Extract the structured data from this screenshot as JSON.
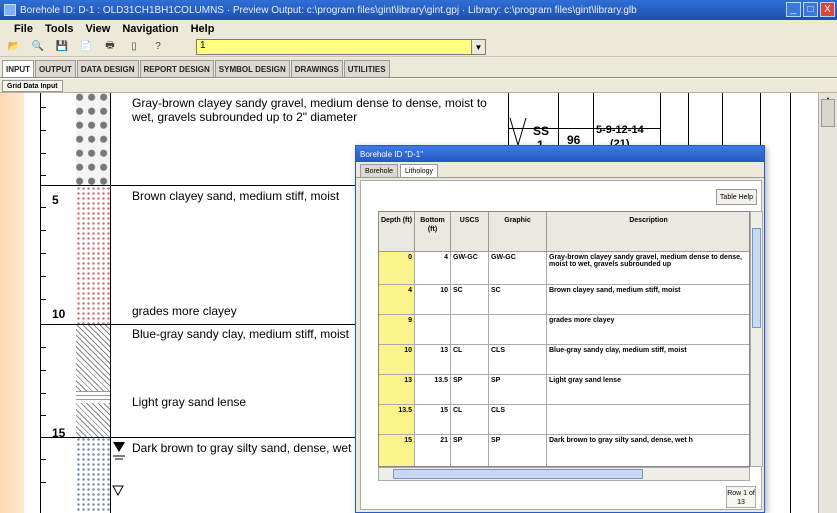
{
  "window": {
    "title": "Borehole ID: D-1 : OLD31CH1BH1COLUMNS · Preview Output: c:\\program files\\gint\\library\\gint.gpj · Library: c:\\program files\\gint\\library.glb",
    "controls": [
      "_",
      "□",
      "X"
    ]
  },
  "menu": [
    "File",
    "Tools",
    "View",
    "Navigation",
    "Help"
  ],
  "combo": {
    "value": "1"
  },
  "tabs": [
    "INPUT",
    "OUTPUT",
    "DATA DESIGN",
    "REPORT DESIGN",
    "SYMBOL DESIGN",
    "DRAWINGS",
    "UTILITIES"
  ],
  "active_tab": "INPUT",
  "subtab": "Grid Data Input",
  "log": {
    "depth_labels": [
      "5",
      "10",
      "15"
    ],
    "descriptions": [
      "Gray-brown clayey sandy gravel, medium dense to dense, moist to wet, gravels subrounded up to 2\" diameter",
      "Brown clayey sand, medium stiff, moist",
      "grades more clayey",
      "Blue-gray sandy clay, medium stiff, moist",
      "Light gray sand lense",
      "Dark brown to gray silty sand, dense, wet"
    ],
    "sample": {
      "type": "SS",
      "number": "1",
      "recovery": "96",
      "blows": "5-9-12-14",
      "extra": "(21)"
    }
  },
  "dialog": {
    "title": "Borehole ID \"D-1\"",
    "tabs": [
      "Borehole",
      "Lithology"
    ],
    "active_tab": "Lithology",
    "table_help": "Table Help",
    "columns": [
      "Depth (ft)",
      "Bottom (ft)",
      "USCS",
      "Graphic",
      "Description"
    ],
    "rows": [
      {
        "depth": "0",
        "bottom": "4",
        "uscs": "GW-GC",
        "graphic": "GW-GC",
        "description": "Gray-brown clayey sandy gravel, medium dense to dense, moist to wet, gravels subrounded up"
      },
      {
        "depth": "4",
        "bottom": "10",
        "uscs": "SC",
        "graphic": "SC",
        "description": "Brown clayey sand, medium stiff, moist"
      },
      {
        "depth": "9",
        "bottom": "",
        "uscs": "",
        "graphic": "",
        "description": "grades more clayey"
      },
      {
        "depth": "10",
        "bottom": "13",
        "uscs": "CL",
        "graphic": "CLS",
        "description": "Blue-gray sandy clay, medium stiff, moist"
      },
      {
        "depth": "13",
        "bottom": "13.5",
        "uscs": "SP",
        "graphic": "SP",
        "description": "Light gray sand lense"
      },
      {
        "depth": "13.5",
        "bottom": "15",
        "uscs": "CL",
        "graphic": "CLS",
        "description": ""
      },
      {
        "depth": "15",
        "bottom": "21",
        "uscs": "SP",
        "graphic": "SP",
        "description": "Dark brown to gray silty sand, dense, wet h"
      }
    ],
    "row_count": "Row 1 of 13"
  }
}
